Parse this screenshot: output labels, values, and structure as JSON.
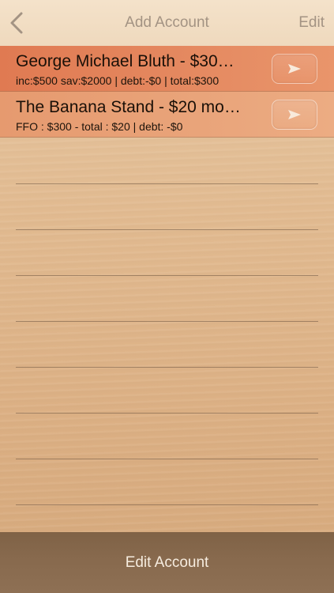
{
  "navbar": {
    "back_icon": "chevron-left-icon",
    "title": "Add Account",
    "edit_label": "Edit"
  },
  "accounts": [
    {
      "title": "George Michael Bluth - $30…",
      "subtitle": "inc:$500 sav:$2000 | debt:-$0 | total:$300",
      "button_icon": "play-arrow-icon",
      "color": "#e07a52"
    },
    {
      "title": "The Banana Stand - $20 mo…",
      "subtitle": "FFO : $300 - total : $20 | debt: -$0",
      "button_icon": "play-arrow-icon",
      "color": "#e69a6f"
    }
  ],
  "footer": {
    "label": "Edit Account"
  },
  "colors": {
    "background": "#e2bb91",
    "navbar": "#efd9bd",
    "nav_text": "#a39383",
    "footer": "#87694d"
  }
}
